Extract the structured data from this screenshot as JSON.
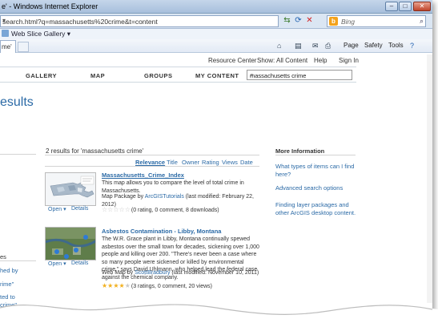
{
  "browser": {
    "title": "e' - Windows Internet Explorer",
    "address": "search.html?q=massachusetts%20crime&t=content",
    "search_engine_placeholder": "Bing",
    "favorites_item": "Web Slice Gallery",
    "tab_label": "me'",
    "commands": [
      "Page",
      "Safety",
      "Tools"
    ]
  },
  "site": {
    "top_links": [
      "Resource Center",
      "Show: All Content",
      "Help",
      "Sign In"
    ],
    "nav": [
      "GALLERY",
      "MAP",
      "GROUPS",
      "MY CONTENT"
    ],
    "search_value": "massachusetts crime",
    "page_title": "esults"
  },
  "results": {
    "count_text": "2 results for 'massachusetts crime'",
    "sort_options": [
      "Relevance",
      "Title",
      "Owner",
      "Rating",
      "Views",
      "Date"
    ],
    "active_sort": "Relevance",
    "open_label": "Open",
    "details_label": "Details",
    "items": [
      {
        "title": "Massachusetts_Crime_Index",
        "description": "This map allows you to compare the level of total crime in Massachusetts.",
        "type_prefix": "Map Package by ",
        "owner": "ArcGISTutorials",
        "modified": " (last modified: February 22, 2012)",
        "rating_text": "(0 rating, 0 comment, 8 downloads)",
        "stars": 0
      },
      {
        "title": "Asbestos Contamination - Libby, Montana",
        "description": "The W.R. Grace plant in Libby, Montana continually spewed asbestos over the small town for decades, sickening over 1,000 people and killing over 200. \"There's never been a case where so many people were sickened or killed by environmental crime,\" says David Uhlmann, who helped lead the federal case against the chemical company.",
        "type_prefix": "Web Map by ",
        "owner": "ScottBradbury",
        "modified": " (last modified: November 10, 2011)",
        "rating_text": "(3 ratings, 0 comment, 20 views)",
        "stars": 4
      }
    ]
  },
  "more_info": {
    "heading": "More Information",
    "links": [
      "What types of items can I find here?",
      "Advanced search options",
      "Finding layer packages and other ArcGIS desktop content."
    ]
  },
  "left_fragments": [
    "es",
    "hed by",
    "rime\"",
    "ted to",
    "crime\""
  ]
}
